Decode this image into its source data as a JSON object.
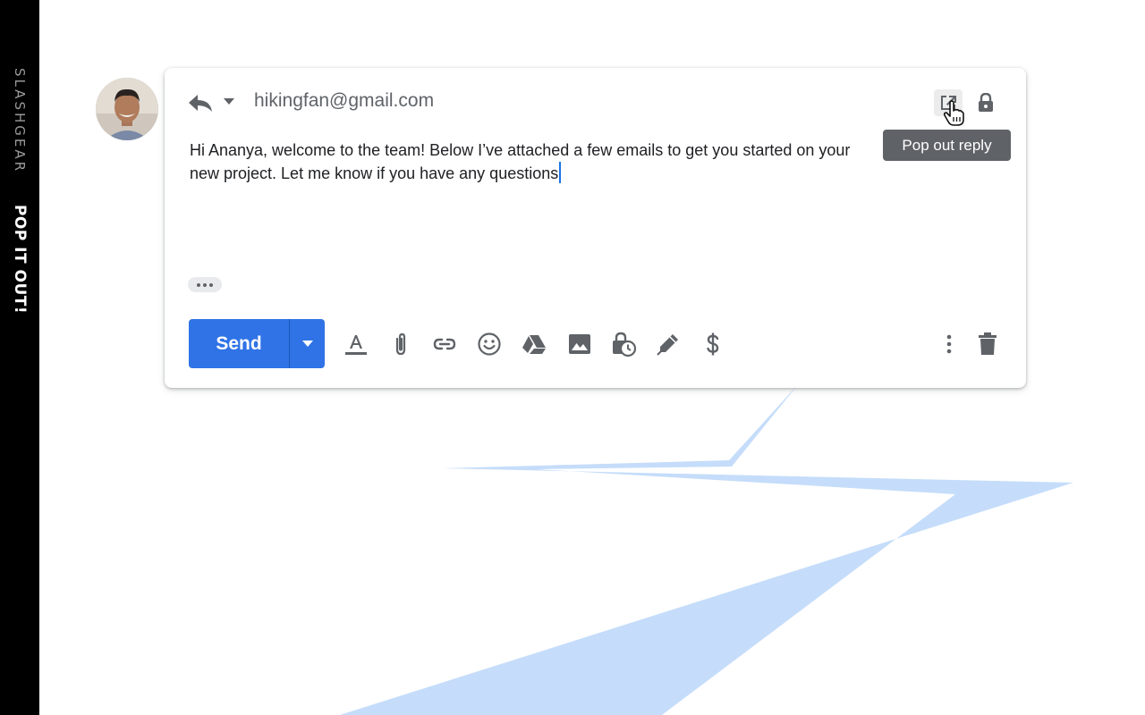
{
  "brand": {
    "logo_text": "SLASHGEAR",
    "tagline": "POP IT OUT!"
  },
  "compose": {
    "recipient": "hikingfan@gmail.com",
    "tooltip": "Pop out reply",
    "body": "Hi Ananya, welcome to the team! Below I’ve attached a few emails to get you started on your new project. Let me know if you have any questions",
    "send_label": "Send"
  },
  "icons": {
    "reply": "reply-icon",
    "reply_options": "chevron-down-icon",
    "pop_out": "pop-out-icon",
    "lock": "lock-icon",
    "cursor": "hand-cursor-icon",
    "trimmed_content": "more-horiz-icon",
    "send_options": "chevron-down-icon",
    "toolbar": [
      "text-format-icon",
      "attach-icon",
      "link-icon",
      "emoji-icon",
      "drive-icon",
      "photo-icon",
      "confidential-mode-icon",
      "signature-icon",
      "dollar-icon",
      "more-vert-icon",
      "trash-icon"
    ]
  },
  "colors": {
    "send_blue": "#2f73e6",
    "arrow_blue": "#c5ddfa",
    "icon_gray": "#5f6368",
    "tooltip_bg": "#5f6368",
    "strip_bg": "#000000"
  }
}
